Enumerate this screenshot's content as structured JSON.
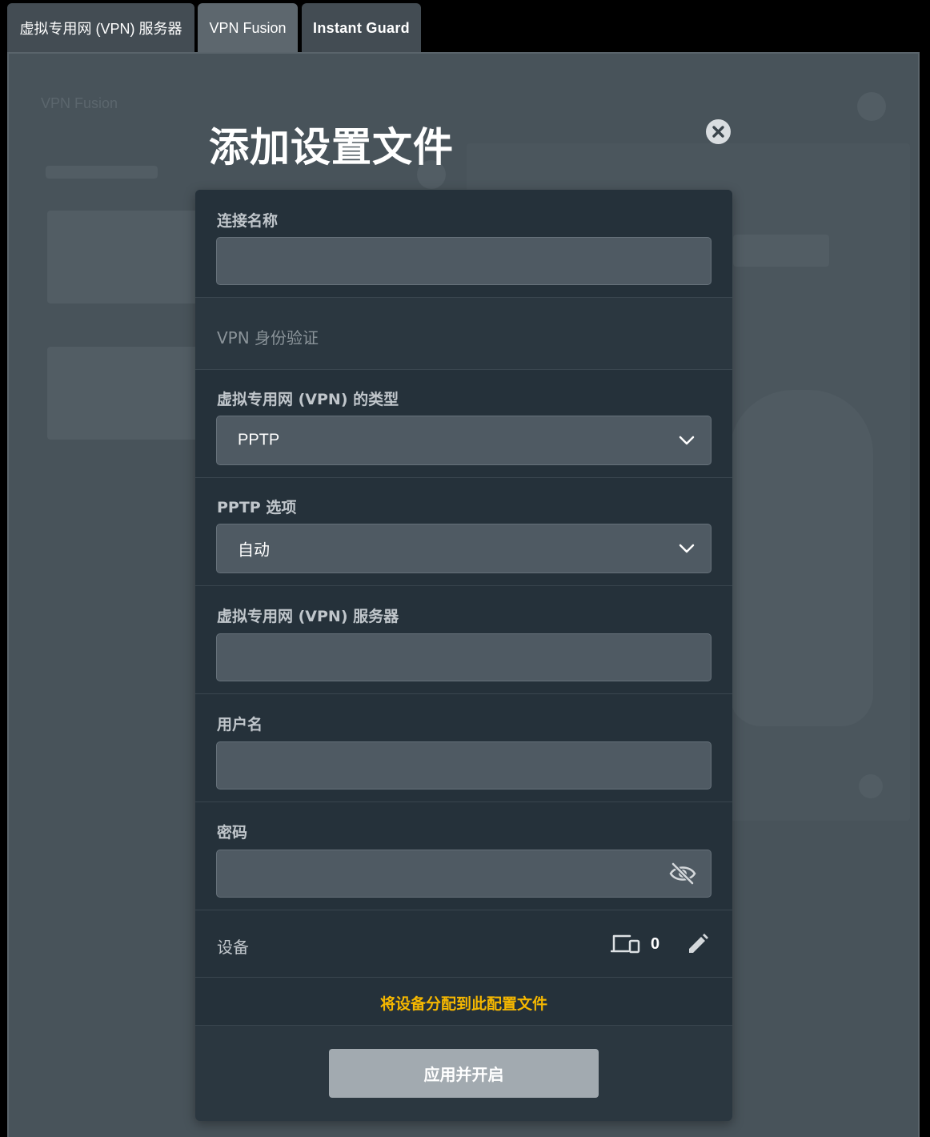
{
  "tabs": [
    {
      "label": "虚拟专用网 (VPN) 服务器"
    },
    {
      "label": "VPN Fusion"
    },
    {
      "label": "Instant Guard"
    }
  ],
  "background": {
    "title": "VPN Fusion"
  },
  "modal": {
    "title": "添加设置文件",
    "connection_name": {
      "label": "连接名称",
      "value": ""
    },
    "auth_section": {
      "label": "VPN 身份验证"
    },
    "vpn_type": {
      "label": "虚拟专用网 (VPN) 的类型",
      "value": "PPTP"
    },
    "pptp_option": {
      "label": "PPTP 选项",
      "value": "自动"
    },
    "vpn_server": {
      "label": "虚拟专用网 (VPN) 服务器",
      "value": ""
    },
    "username": {
      "label": "用户名",
      "value": ""
    },
    "password": {
      "label": "密码",
      "value": ""
    },
    "devices": {
      "label": "设备",
      "count": "0"
    },
    "assign_link": "将设备分配到此配置文件",
    "apply_button": "应用并开启"
  },
  "colors": {
    "accent": "#f5b700",
    "modal_bg": "#25313a",
    "field_bg": "#4f5a63"
  }
}
